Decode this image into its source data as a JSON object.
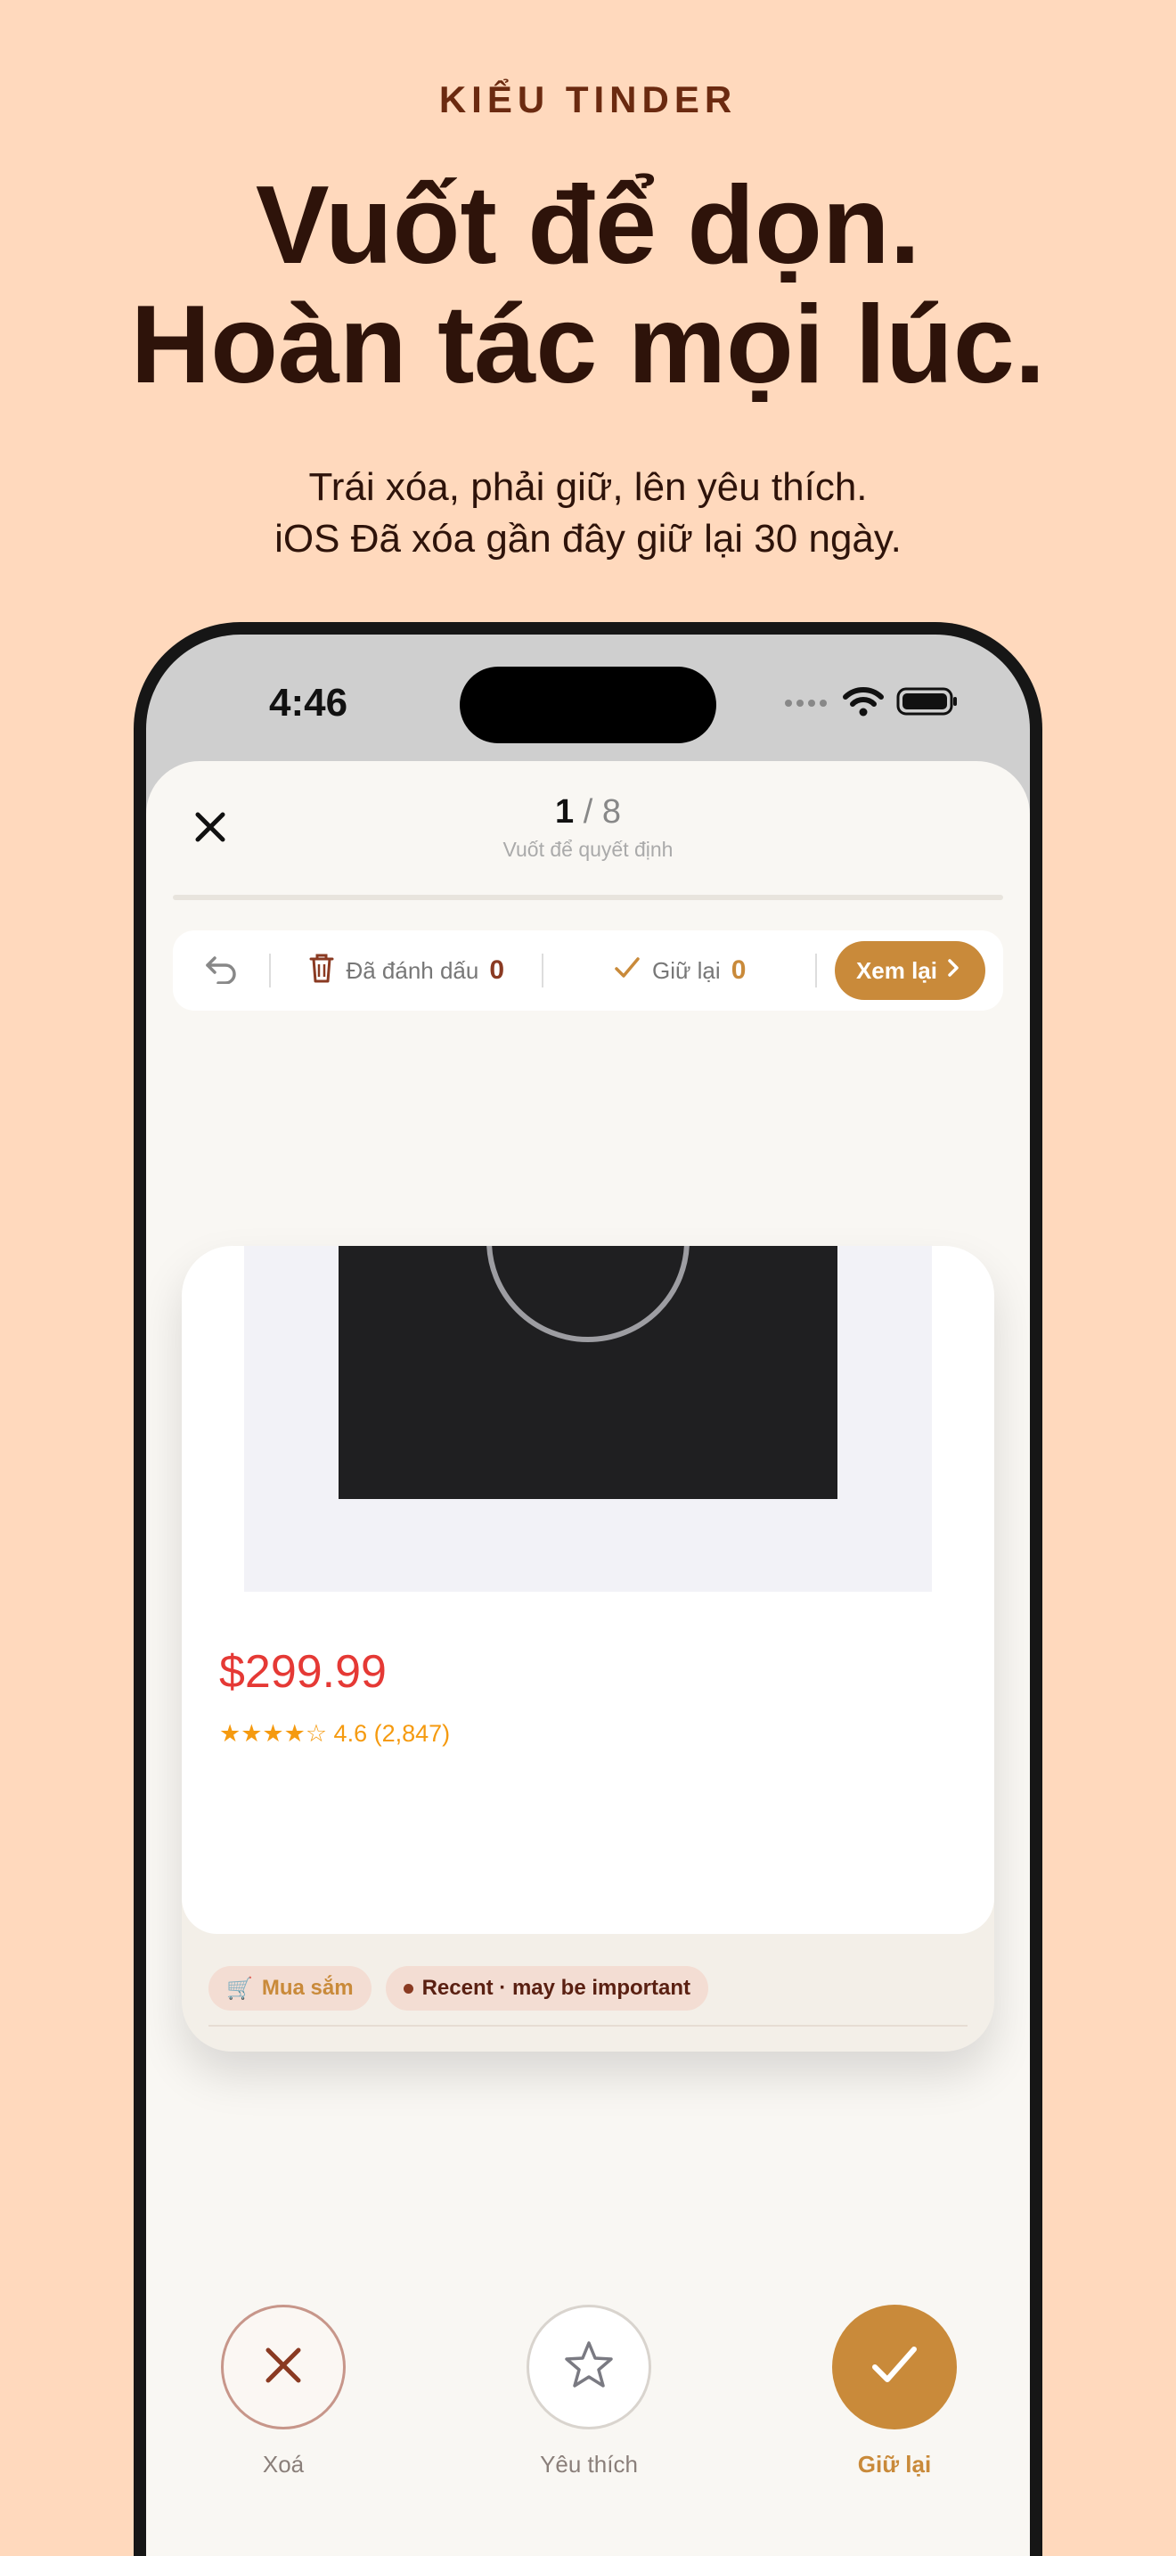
{
  "promo": {
    "eyebrow": "KIỂU TINDER",
    "headline_line1": "Vuốt để dọn.",
    "headline_line2": "Hoàn tác mọi lúc.",
    "subtitle_line1": "Trái xóa, phải giữ, lên yêu thích.",
    "subtitle_line2": "iOS Đã xóa gần đây giữ lại 30 ngày."
  },
  "status_bar": {
    "time": "4:46",
    "icons": [
      "signal-icon",
      "wifi-icon",
      "battery-icon"
    ]
  },
  "header": {
    "current": "1",
    "separator": "/",
    "total": "8",
    "subtitle": "Vuốt để quyết định",
    "close_icon": "close-icon"
  },
  "toolbar": {
    "undo_icon": "undo-icon",
    "marked_label": "Đã đánh dấu",
    "marked_count": "0",
    "kept_label": "Giữ lại",
    "kept_count": "0",
    "review_label": "Xem lại"
  },
  "card": {
    "price": "$299.99",
    "rating_stars": "★★★★☆",
    "rating_value": "4.6 (2,847)",
    "tags": [
      {
        "icon": "🛒",
        "label": "Mua sắm"
      },
      {
        "label": "Recent · may be important"
      }
    ]
  },
  "actions": {
    "delete_label": "Xoá",
    "favorite_label": "Yêu thích",
    "keep_label": "Giữ lại"
  },
  "colors": {
    "background": "#ffd9bd",
    "accent": "#c98a3a",
    "danger": "#8a3a22",
    "price": "#e53935"
  }
}
